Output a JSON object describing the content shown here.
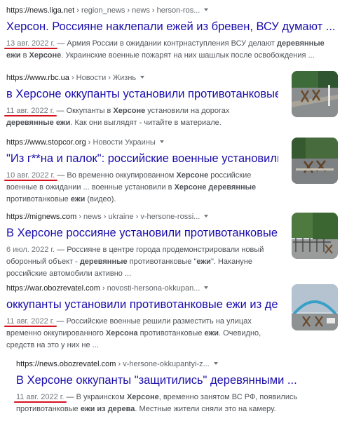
{
  "results": [
    {
      "url": "https://news.liga.net",
      "path": " › region_news › news › herson-ros...",
      "title": "Херсон. Россияне наклепали ежей из бревен, ВСУ думают ...",
      "date": "13 авг. 2022 г.",
      "text1": " — Армия России в ожидании контрнаступления ВСУ делают ",
      "bold1": "деревянные ежи",
      "text2": " в ",
      "bold2": "Херсоне",
      "text3": ". Украинские военные пожарят на них шашлык после освобождения ..."
    },
    {
      "url": "https://www.rbc.ua",
      "path": " › Новости › Жизнь",
      "title": "в Херсоне оккупанты установили противотанковые ежи ...",
      "date": "11 авг. 2022 г.",
      "text1": " — Оккупанты в ",
      "bold1": "Херсоне",
      "text2": " установили на дорогах ",
      "bold2": "деревянные ежи",
      "text3": ". Как они выглядят - читайте в материале."
    },
    {
      "url": "https://www.stopcor.org",
      "path": " › Новости Украины",
      "title": "\"Из г**на и палок\": российские военные установили в ...",
      "date": "10 авг. 2022 г.",
      "text1": " — Во временно оккупированном ",
      "bold1": "Херсоне",
      "text2": " российские военные в ожидании ... военные установили в ",
      "bold2": "Херсоне деревянные",
      "text3": " противотанковые ",
      "bold3": "ежи",
      "text4": " (видео)."
    },
    {
      "url": "https://mignews.com",
      "path": " › news › ukraine › v-hersone-rossi...",
      "title": "В Херсоне россияне установили противотанковые \"ежи ...",
      "date": "6 июл. 2022 г.",
      "text1": " — Россияне в центре города продемонстрировали новый оборонный объект - ",
      "bold1": "деревянные",
      "text2": " противотанковые \"",
      "bold2": "ежи",
      "text3": "\". Накануне российские автомобили активно ..."
    },
    {
      "url": "https://war.obozrevatel.com",
      "path": " › novosti-hersona-okkupan...",
      "title": "оккупанты установили противотанковые ежи из дерева ...",
      "date": "11 авг. 2022 г.",
      "text1": " — Российские военные решили разместить на улицах временно оккупированного ",
      "bold1": "Херсона",
      "text2": " противотанковые ",
      "bold2": "ежи",
      "text3": ". Очевидно, средств на это у них не ..."
    },
    {
      "url": "https://news.obozrevatel.com",
      "path": " › v-hersone-okkupantyi-z...",
      "title": "В Херсоне оккупанты \"защитились\" деревянными ...",
      "date": "11 авг. 2022 г.",
      "text1": " — В украинском ",
      "bold1": "Херсоне",
      "text2": ", временно занятом ВС РФ, появились противотанковые ",
      "bold2": "ежи из дерева",
      "text3": ". Местные жители сняли это на камеру."
    }
  ],
  "thumbnails": [
    "road-hedgehogs-photo",
    "barricade-photo",
    "street-barrier-photo",
    "bridge-hedgehogs-photo"
  ],
  "colors": {
    "link": "#1a0dab",
    "snippet": "#4d5156",
    "underline": "#d6121f"
  }
}
